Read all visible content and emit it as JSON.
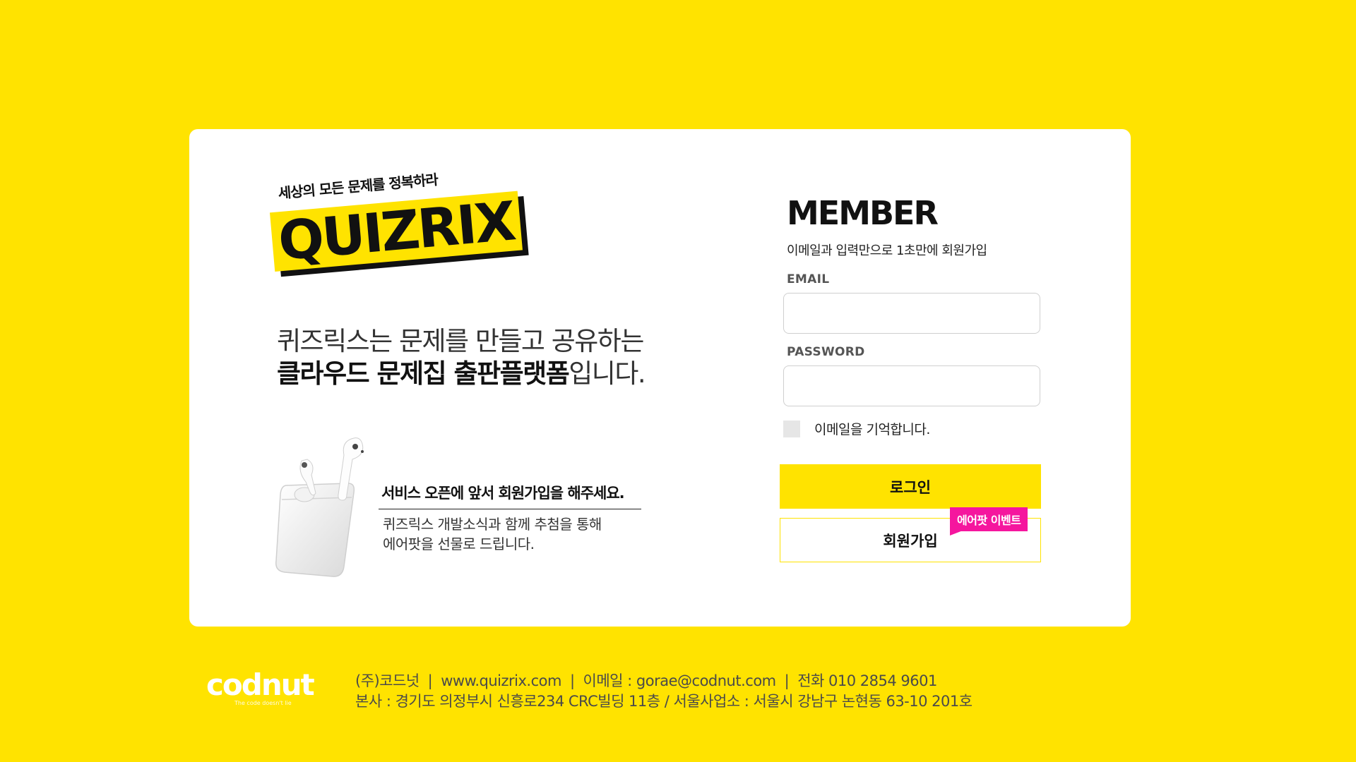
{
  "brand": {
    "slogan": "세상의 모든 문제를 정복하라",
    "logo": "QUIZRIX"
  },
  "intro": {
    "line1": "퀴즈릭스는 문제를 만들고 공유하는",
    "line2_bold": "클라우드 문제집 출판플랫폼",
    "line2_tail": "입니다."
  },
  "promo": {
    "heading": "서비스 오픈에 앞서 회원가입을 해주세요.",
    "body_line1": "퀴즈릭스 개발소식과 함께 추첨을 통해",
    "body_line2": "에어팟을 선물로 드립니다."
  },
  "login": {
    "title": "MEMBER",
    "subtitle": "이메일과 입력만으로 1초만에 회원가입",
    "email_label": "EMAIL",
    "email_value": "",
    "password_label": "PASSWORD",
    "password_value": "",
    "remember_label": "이메일을 기억합니다.",
    "remember_checked": false,
    "login_button": "로그인",
    "join_button": "회원가입",
    "event_badge": "에어팟 이벤트"
  },
  "footer": {
    "logo": "codnut",
    "logo_tagline": "The code doesn't lie",
    "company": "(주)코드넛",
    "website": "www.quizrix.com",
    "email": "이메일 : gorae@codnut.com",
    "phone": "전화 010 2854 9601",
    "address": "본사 : 경기도 의정부시 신흥로234 CRC빌딩 11층 / 서울사업소 : 서울시 강남구 논현동 63-10 201호"
  },
  "colors": {
    "background": "#FFE300",
    "accent": "#FFE300",
    "badge": "#F5169E"
  }
}
